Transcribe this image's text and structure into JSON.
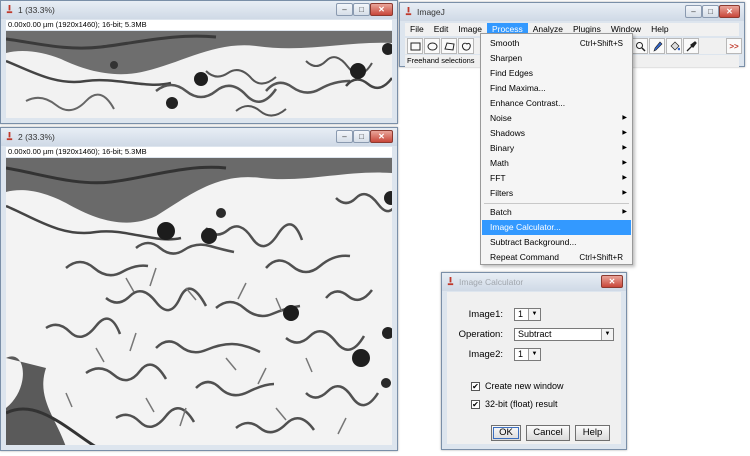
{
  "window1": {
    "title": "1 (33.3%)",
    "info": "0.00x0.00 µm (1920x1460); 16-bit; 5.3MB",
    "controls": {
      "minimize": "–",
      "maximize": "□",
      "close": "✕"
    }
  },
  "window2": {
    "title": "2 (33.3%)",
    "info": "0.00x0.00 µm (1920x1460); 16-bit; 5.3MB",
    "controls": {
      "minimize": "–",
      "maximize": "□",
      "close": "✕"
    }
  },
  "imagej": {
    "title": "ImageJ",
    "controls": {
      "minimize": "–",
      "maximize": "□",
      "close": "✕"
    },
    "menus": [
      "File",
      "Edit",
      "Image",
      "Process",
      "Analyze",
      "Plugins",
      "Window",
      "Help"
    ],
    "active_menu": "Process",
    "status": "Freehand selections",
    "more_tools": ">>"
  },
  "process_menu": {
    "items": [
      {
        "label": "Smooth",
        "shortcut": "Ctrl+Shift+S"
      },
      {
        "label": "Sharpen"
      },
      {
        "label": "Find Edges"
      },
      {
        "label": "Find Maxima..."
      },
      {
        "label": "Enhance Contrast..."
      },
      {
        "label": "Noise",
        "submenu": true
      },
      {
        "label": "Shadows",
        "submenu": true
      },
      {
        "label": "Binary",
        "submenu": true
      },
      {
        "label": "Math",
        "submenu": true
      },
      {
        "label": "FFT",
        "submenu": true
      },
      {
        "label": "Filters",
        "submenu": true
      },
      {
        "label": "Batch",
        "submenu": true
      },
      {
        "label": "Image Calculator...",
        "highlighted": true
      },
      {
        "label": "Subtract Background..."
      },
      {
        "label": "Repeat Command",
        "shortcut": "Ctrl+Shift+R"
      }
    ],
    "submenu_arrow": "▶"
  },
  "calculator": {
    "title": "Image Calculator",
    "controls": {
      "close": "✕"
    },
    "image1_label": "Image1:",
    "image1_value": "1",
    "operation_label": "Operation:",
    "operation_value": "Subtract",
    "image2_label": "Image2:",
    "image2_value": "1",
    "dropdown_arrow": "▼",
    "create_new_window": {
      "label": "Create new window",
      "checked": true
    },
    "float_result": {
      "label": "32-bit (float) result",
      "checked": true
    },
    "check_mark": "✔",
    "buttons": {
      "ok": "OK",
      "cancel": "Cancel",
      "help": "Help"
    }
  },
  "colors": {
    "accent": "#3399ff",
    "titlebar": "#d8e2ee",
    "close_button": "#c8473a"
  }
}
